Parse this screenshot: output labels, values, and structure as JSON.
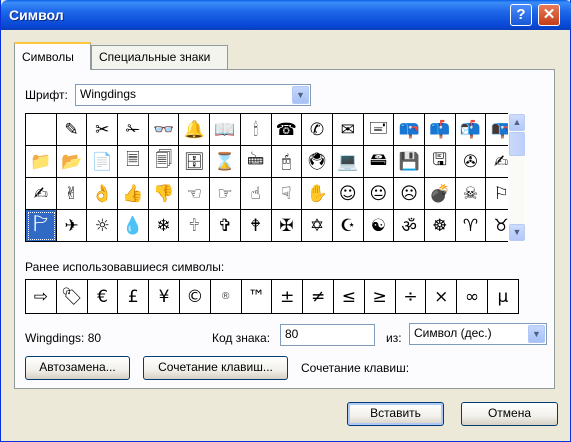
{
  "window": {
    "title": "Символ",
    "help_glyph": "?",
    "close_glyph": "✕"
  },
  "tabs": [
    {
      "label": "Символы",
      "active": true
    },
    {
      "label": "Специальные знаки",
      "active": false
    }
  ],
  "font": {
    "label": "Шрифт:",
    "value": "Wingdings"
  },
  "symbol_grid": {
    "rows": [
      [
        " ",
        "✎",
        "✂",
        "✁",
        "👓",
        "🔔",
        "📖",
        "🕯",
        "☎",
        "✆",
        "✉",
        "🖃",
        "📪",
        "📫",
        "📬",
        "📭"
      ],
      [
        "📁",
        "📂",
        "📄",
        "🗏",
        "🗐",
        "🗄",
        "⌛",
        "🖮",
        "🖰",
        "🖲",
        "💻",
        "🖴",
        "💾",
        "🖫",
        "✇",
        "✍"
      ],
      [
        "✍",
        "✌",
        "👌",
        "👍",
        "👎",
        "☜",
        "☞",
        "☝",
        "☟",
        "✋",
        "☺",
        "😐",
        "☹",
        "💣",
        "☠",
        "⚐"
      ],
      [
        "🏱",
        "✈",
        "☼",
        "💧",
        "❄",
        "🕆",
        "✞",
        "🕈",
        "✠",
        "✡",
        "☪",
        "☯",
        "ॐ",
        "☸",
        "♈",
        "♉"
      ]
    ],
    "selected": {
      "row": 3,
      "col": 0
    }
  },
  "recent": {
    "label": "Ранее использовавшиеся символы:",
    "symbols": [
      "⇨",
      "🏷",
      "€",
      "£",
      "¥",
      "©",
      "®",
      "™",
      "±",
      "≠",
      "≤",
      "≥",
      "÷",
      "×",
      "∞",
      "µ"
    ]
  },
  "info": {
    "font_code": "Wingdings: 80",
    "code_label": "Код знака:",
    "code_value": "80",
    "from_label": "из:",
    "from_value": "Символ (дес.)"
  },
  "buttons": {
    "autocorrect": "Автозамена...",
    "shortcut": "Сочетание клавиш...",
    "shortcut_label": "Сочетание клавиш:",
    "insert": "Вставить",
    "cancel": "Отмена"
  }
}
